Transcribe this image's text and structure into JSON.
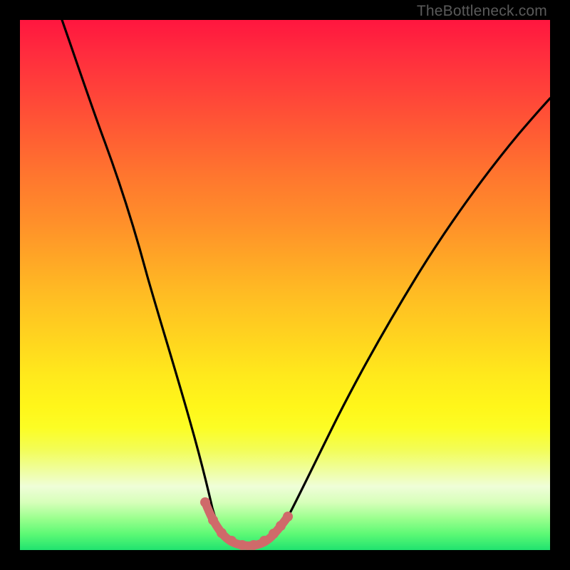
{
  "watermark": "TheBottleneck.com",
  "colors": {
    "frame": "#000000",
    "curve": "#000000",
    "markers": "#cf6a6a"
  },
  "chart_data": {
    "type": "line",
    "title": "",
    "xlabel": "",
    "ylabel": "",
    "xlim": [
      0,
      100
    ],
    "ylim": [
      0,
      100
    ],
    "grid": false,
    "legend": false,
    "annotations": [
      "TheBottleneck.com"
    ],
    "series": [
      {
        "name": "bottleneck-curve",
        "x": [
          8,
          12,
          16,
          20,
          24,
          28,
          31,
          33.5,
          35,
          36.5,
          38,
          40,
          42,
          44,
          46,
          48,
          50,
          55,
          60,
          65,
          70,
          75,
          80,
          85,
          90,
          95,
          100
        ],
        "y": [
          100,
          89,
          77,
          65,
          52,
          38,
          25,
          14,
          9,
          5,
          2.5,
          1.2,
          0.8,
          0.8,
          1.2,
          2.5,
          5,
          13,
          21,
          29,
          36,
          43,
          49,
          54,
          59,
          63,
          67
        ]
      },
      {
        "name": "minimum-markers",
        "x": [
          35,
          36.5,
          38,
          40,
          42,
          44,
          46,
          48,
          49.5,
          51
        ],
        "y": [
          9,
          5,
          2.5,
          1.2,
          0.8,
          0.8,
          1.2,
          2.5,
          4,
          6
        ]
      }
    ]
  }
}
